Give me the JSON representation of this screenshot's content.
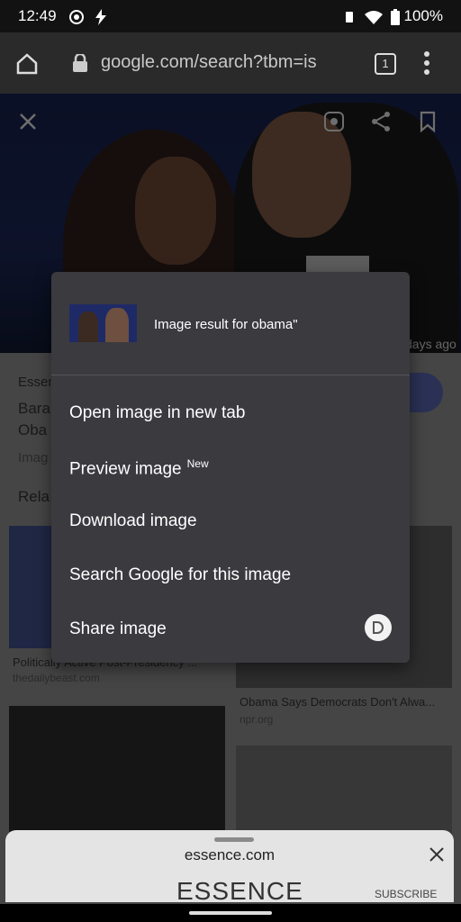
{
  "status_bar": {
    "time": "12:49",
    "battery": "100%"
  },
  "url_bar": {
    "url": "google.com/search?tbm=isch",
    "tab_count": "1"
  },
  "background_page": {
    "source_site": "Essen",
    "title_line1": "Bara",
    "title_line2": "Oba",
    "meta": "Imag",
    "related": "Rela",
    "time_ago": "days ago",
    "card1_caption": "Politically Active Post-Presidency ...",
    "card1_site": "thedailybeast.com",
    "card2_caption": "Obama Says Democrats Don't Alwa...",
    "card2_site": "npr.org"
  },
  "bottom_sheet": {
    "domain": "essence.com",
    "brand": "ESSENCE",
    "subscribe": "SUBSCRIBE"
  },
  "context_menu": {
    "header_title": "Image result for obama\"",
    "items": [
      {
        "label": "Open image in new tab"
      },
      {
        "label": "Preview image",
        "badge": "New"
      },
      {
        "label": "Download image"
      },
      {
        "label": "Search Google for this image"
      },
      {
        "label": "Share image"
      }
    ]
  }
}
